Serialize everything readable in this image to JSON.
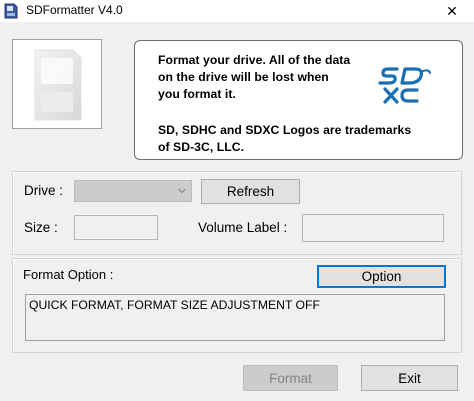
{
  "window": {
    "title": "SDFormatter V4.0",
    "close_glyph": "✕"
  },
  "info": {
    "lines": [
      "Format your drive. All of the data",
      "on the drive will be lost when",
      "you format it.",
      "SD, SDHC and SDXC Logos are trademarks",
      "of SD-3C, LLC."
    ],
    "logo_accent_color": "#1a6fb3"
  },
  "drive": {
    "label": "Drive :",
    "selected": "",
    "refresh_label": "Refresh",
    "size_label": "Size  :",
    "size_value": "",
    "volume_label": "Volume Label  :",
    "volume_value": ""
  },
  "format_option": {
    "label": "Format Option :",
    "option_button_label": "Option",
    "current_setting": "QUICK FORMAT, FORMAT SIZE ADJUSTMENT OFF"
  },
  "actions": {
    "format_label": "Format",
    "exit_label": "Exit"
  },
  "icons": {
    "app": "sd-card-icon",
    "sd_card_image": "sd-card-graphic",
    "logo": "sdxc-logo-icon",
    "dropdown": "chevron-down-icon",
    "close": "close-icon"
  }
}
